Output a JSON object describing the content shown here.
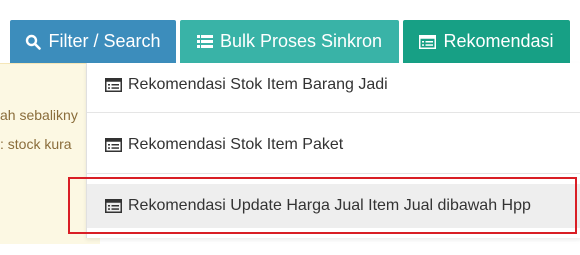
{
  "toolbar": {
    "filter_search_label": "Filter / Search",
    "bulk_sync_label": "Bulk Proses Sinkron",
    "rekomendasi_label": "Rekomendasi"
  },
  "notice": {
    "line1": "ah sebalikny",
    "line2": ": stock kura"
  },
  "dropdown": {
    "items": [
      {
        "label": "Rekomendasi Stok Item Barang Jadi"
      },
      {
        "label": "Rekomendasi Stok Item Paket"
      },
      {
        "label": "Rekomendasi Update Harga Jual Item Jual dibawah Hpp"
      }
    ]
  },
  "colors": {
    "primary_blue": "#3c8dbc",
    "teal": "#39b3a7",
    "dark_teal": "#17a085",
    "highlight_red": "#d91e25",
    "notice_bg": "#fcf8e3"
  },
  "icons": {
    "filter_button": "search-icon",
    "bulk_button": "list-icon",
    "rekomendasi_button": "list-alt-icon",
    "menu_items": "list-alt-icon"
  }
}
